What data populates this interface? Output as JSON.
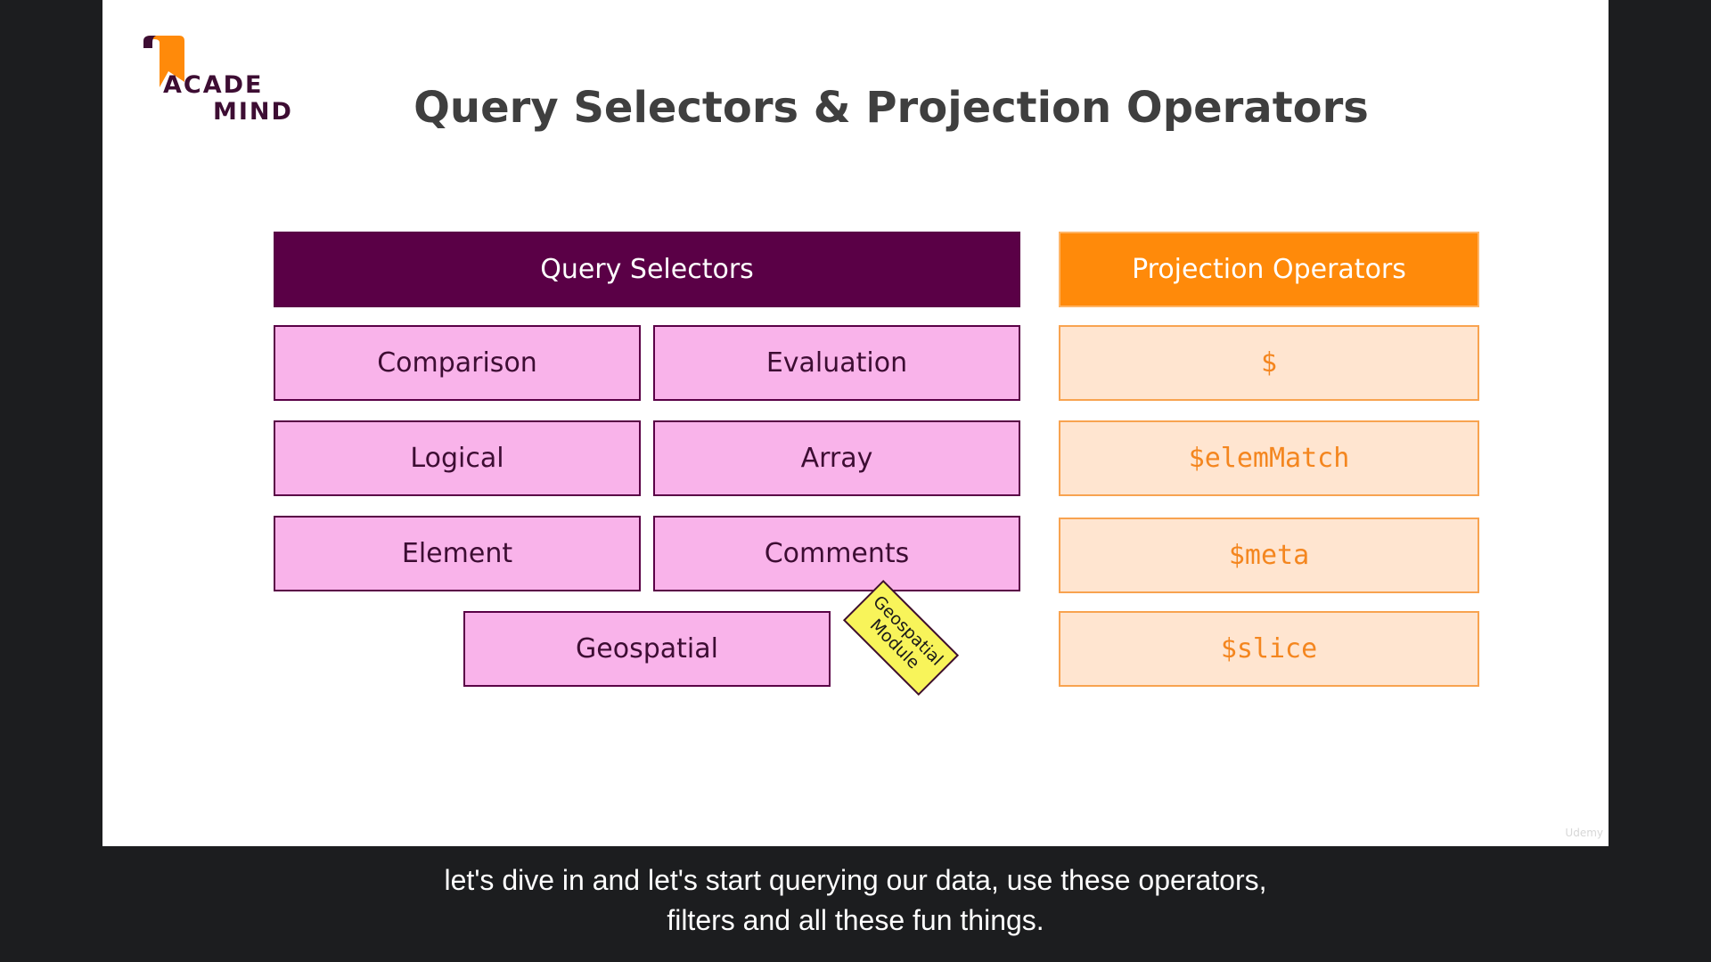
{
  "logo": {
    "line1": "ACADE",
    "line2": "MIND",
    "brand_color": "#3d0d33",
    "accent_color": "#ff8a0a"
  },
  "title": "Query Selectors & Projection Operators",
  "query_selectors": {
    "header": "Query Selectors",
    "items": [
      "Comparison",
      "Evaluation",
      "Logical",
      "Array",
      "Element",
      "Comments",
      "Geospatial"
    ],
    "note": {
      "line1": "Geospatial",
      "line2": "Module"
    },
    "header_color": "#5a0046",
    "item_color": "#f9b3ea"
  },
  "projection_operators": {
    "header": "Projection Operators",
    "items": [
      "$",
      "$elemMatch",
      "$meta",
      "$slice"
    ],
    "header_color": "#ff8a0a",
    "item_color": "#ffe5d0"
  },
  "watermark": "Udemy",
  "captions": {
    "line1": "let's dive in and let's start querying our data, use these operators,",
    "line2": "filters and all these fun things."
  }
}
